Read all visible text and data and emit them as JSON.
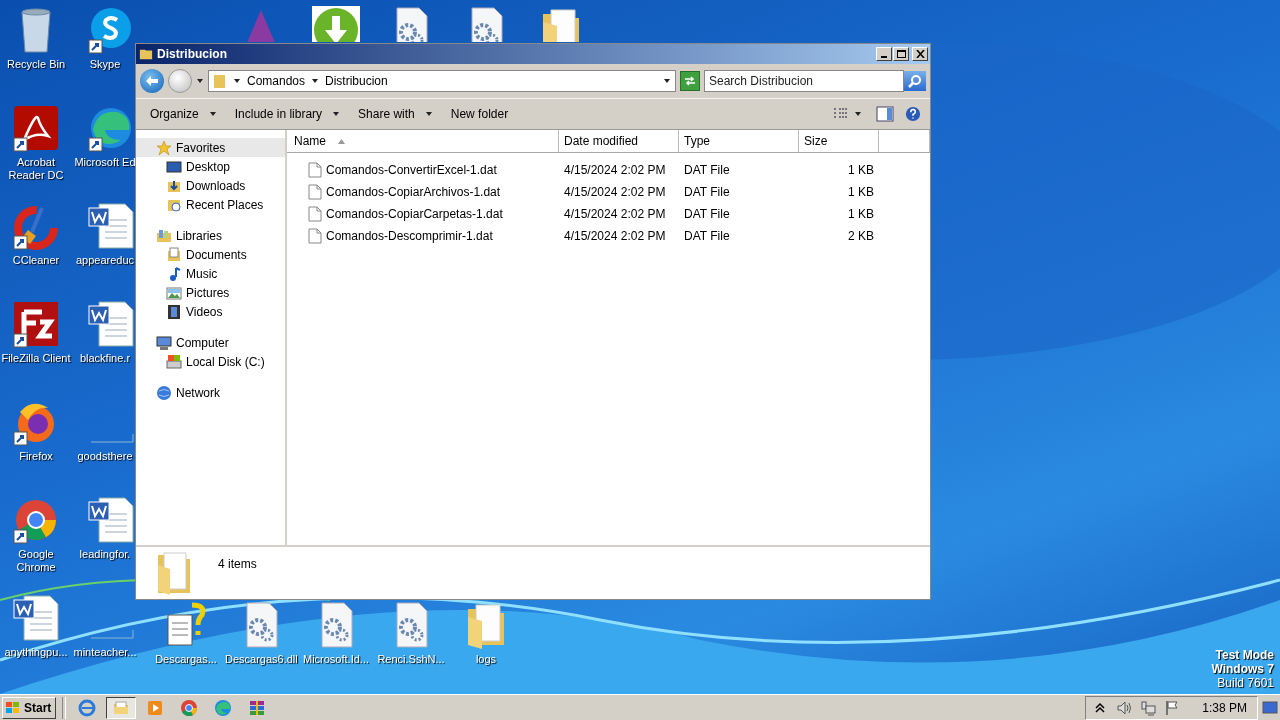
{
  "desktop": {
    "column_1": [
      {
        "label": "Recycle Bin",
        "kind": "recycle",
        "shortcut": false
      },
      {
        "label": "Acrobat Reader DC",
        "kind": "acrobat",
        "shortcut": true
      },
      {
        "label": "CCleaner",
        "kind": "ccleaner",
        "shortcut": true
      },
      {
        "label": "FileZilla Client",
        "kind": "filezilla",
        "shortcut": true
      },
      {
        "label": "Firefox",
        "kind": "firefox",
        "shortcut": true
      },
      {
        "label": "Google Chrome",
        "kind": "chrome",
        "shortcut": true
      },
      {
        "label": "anythingpu...",
        "kind": "word",
        "shortcut": false
      }
    ],
    "column_2": [
      {
        "label": "Skype",
        "kind": "skype",
        "shortcut": true
      },
      {
        "label": "Microsoft Ed",
        "kind": "edge",
        "shortcut": true
      },
      {
        "label": "appeareduc",
        "kind": "word",
        "shortcut": false
      },
      {
        "label": "blackfine.r",
        "kind": "word",
        "shortcut": false
      },
      {
        "label": "goodsthere",
        "kind": "blank",
        "shortcut": false
      },
      {
        "label": "leadingfor.",
        "kind": "word",
        "shortcut": false
      },
      {
        "label": "minteacher...",
        "kind": "blank",
        "shortcut": false
      }
    ],
    "top_row": [
      {
        "kind": "triangle"
      },
      {
        "kind": "download"
      },
      {
        "kind": "gear"
      },
      {
        "kind": "gear"
      },
      {
        "kind": "folder"
      }
    ],
    "bottom_row": [
      {
        "label": "Descargas...",
        "kind": "help",
        "shortcut": false
      },
      {
        "label": "Descargas6.dll",
        "kind": "gear",
        "shortcut": false
      },
      {
        "label": "Microsoft.Id...",
        "kind": "gear",
        "shortcut": false
      },
      {
        "label": "Renci.SshN...",
        "kind": "gear",
        "shortcut": false
      },
      {
        "label": "logs",
        "kind": "folder",
        "shortcut": false
      }
    ],
    "edition": [
      "Test Mode",
      "Windows 7"
    ],
    "build": "Build 7601"
  },
  "window": {
    "title": "Distribucion",
    "breadcrumb": [
      "Comandos",
      "Distribucion"
    ],
    "search": {
      "placeholder": "Search Distribucion"
    },
    "toolbar": [
      "Organize",
      "Include in library",
      "Share with",
      "New folder"
    ],
    "toolbar_menus": [
      true,
      true,
      true,
      false
    ],
    "navigation": [
      {
        "label": "Favorites",
        "kind": "star",
        "selected": true,
        "children": [
          {
            "label": "Desktop",
            "kind": "desktop",
            "selected": false
          },
          {
            "label": "Downloads",
            "kind": "downloads",
            "selected": false
          },
          {
            "label": "Recent Places",
            "kind": "recent",
            "selected": false
          }
        ]
      },
      {
        "label": "Libraries",
        "kind": "library",
        "selected": false,
        "children": [
          {
            "label": "Documents",
            "kind": "documents",
            "selected": false
          },
          {
            "label": "Music",
            "kind": "music",
            "selected": false
          },
          {
            "label": "Pictures",
            "kind": "pictures",
            "selected": false
          },
          {
            "label": "Videos",
            "kind": "videos",
            "selected": false
          }
        ]
      },
      {
        "label": "Computer",
        "kind": "computer",
        "selected": false,
        "children": [
          {
            "label": "Local Disk (C:)",
            "kind": "disk",
            "selected": false
          }
        ]
      },
      {
        "label": "Network",
        "kind": "network",
        "selected": false
      }
    ],
    "columns": [
      {
        "label": "Name",
        "sorted": true
      },
      {
        "label": "Date modified",
        "sorted": false
      },
      {
        "label": "Type",
        "sorted": false
      },
      {
        "label": "Size",
        "sorted": false
      }
    ],
    "rows": [
      {
        "selected": false,
        "cells": [
          "Comandos-ConvertirExcel-1.dat",
          "4/15/2024 2:02 PM",
          "DAT File",
          "1 KB"
        ]
      },
      {
        "selected": false,
        "cells": [
          "Comandos-CopiarArchivos-1.dat",
          "4/15/2024 2:02 PM",
          "DAT File",
          "1 KB"
        ]
      },
      {
        "selected": false,
        "cells": [
          "Comandos-CopiarCarpetas-1.dat",
          "4/15/2024 2:02 PM",
          "DAT File",
          "1 KB"
        ]
      },
      {
        "selected": false,
        "cells": [
          "Comandos-Descomprimir-1.dat",
          "4/15/2024 2:02 PM",
          "DAT File",
          "2 KB"
        ]
      }
    ],
    "status": "4 items"
  },
  "taskbar": {
    "start": "Start",
    "buttons": [
      {
        "kind": "ie",
        "active": false
      },
      {
        "kind": "explorer",
        "active": true
      },
      {
        "kind": "media",
        "active": false
      },
      {
        "kind": "chrome",
        "active": false
      },
      {
        "kind": "edge",
        "active": false
      },
      {
        "kind": "winrar",
        "active": false
      }
    ],
    "time": "1:38 PM"
  }
}
